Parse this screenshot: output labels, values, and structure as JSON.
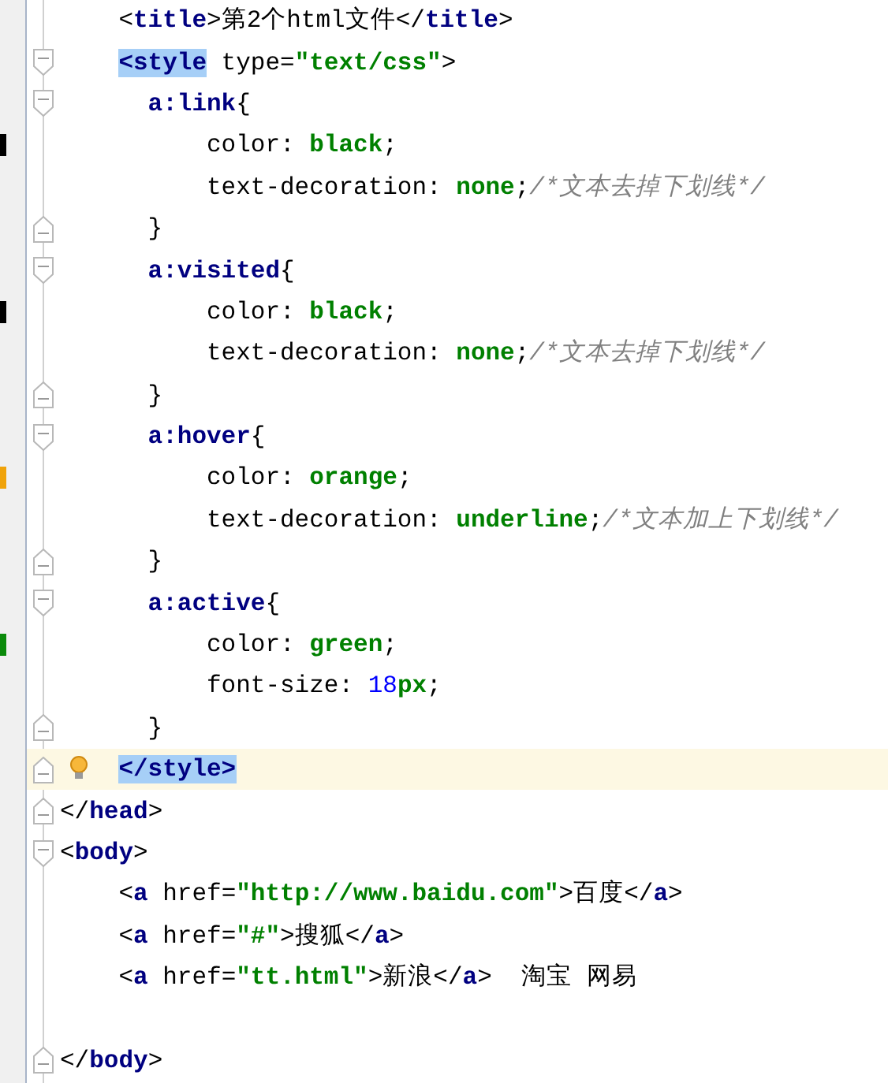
{
  "lines": [
    {
      "kind": "element",
      "fold_open": false,
      "fold_close": false,
      "tokens": [
        {
          "kind": "punct",
          "text": "<"
        },
        {
          "kind": "tag",
          "text": "title"
        },
        {
          "kind": "punct",
          "text": ">"
        },
        {
          "kind": "text",
          "text": "第2个html文件"
        },
        {
          "kind": "punct",
          "text": "</"
        },
        {
          "kind": "tag",
          "text": "title"
        },
        {
          "kind": "punct",
          "text": ">"
        }
      ]
    },
    {
      "kind": "element",
      "fold_open": true,
      "fold_close": false,
      "tokens": [
        {
          "kind": "tag",
          "text": "<style",
          "highlighted": true
        },
        {
          "kind": "attr",
          "text": " type="
        },
        {
          "kind": "string",
          "text": "\"text/css\""
        },
        {
          "kind": "punct",
          "text": ">"
        }
      ]
    },
    {
      "kind": "rule",
      "fold_open": true,
      "fold_close": false,
      "tokens": [
        {
          "kind": "selector",
          "text": "a:link"
        },
        {
          "kind": "punct",
          "text": "{"
        }
      ]
    },
    {
      "kind": "declaration",
      "fold_open": false,
      "fold_close": false,
      "color": "#000000",
      "tokens": [
        {
          "kind": "prop",
          "text": "color: "
        },
        {
          "kind": "value",
          "text": "black"
        },
        {
          "kind": "punct",
          "text": ";"
        }
      ]
    },
    {
      "kind": "declaration",
      "fold_open": false,
      "fold_close": false,
      "tokens": [
        {
          "kind": "prop",
          "text": "text-decoration: "
        },
        {
          "kind": "value",
          "text": "none"
        },
        {
          "kind": "punct",
          "text": ";"
        },
        {
          "kind": "comment",
          "text": "/*文本去掉下划线*/"
        }
      ]
    },
    {
      "kind": "rule",
      "fold_open": false,
      "fold_close": true,
      "tokens": [
        {
          "kind": "punct",
          "text": "}"
        }
      ]
    },
    {
      "kind": "rule",
      "fold_open": true,
      "fold_close": false,
      "tokens": [
        {
          "kind": "selector",
          "text": "a:visited"
        },
        {
          "kind": "punct",
          "text": "{"
        }
      ]
    },
    {
      "kind": "declaration",
      "fold_open": false,
      "fold_close": false,
      "color": "#000000",
      "tokens": [
        {
          "kind": "prop",
          "text": "color: "
        },
        {
          "kind": "value",
          "text": "black"
        },
        {
          "kind": "punct",
          "text": ";"
        }
      ]
    },
    {
      "kind": "declaration",
      "fold_open": false,
      "fold_close": false,
      "tokens": [
        {
          "kind": "prop",
          "text": "text-decoration: "
        },
        {
          "kind": "value",
          "text": "none"
        },
        {
          "kind": "punct",
          "text": ";"
        },
        {
          "kind": "comment",
          "text": "/*文本去掉下划线*/"
        }
      ]
    },
    {
      "kind": "rule",
      "fold_open": false,
      "fold_close": true,
      "tokens": [
        {
          "kind": "punct",
          "text": "}"
        }
      ]
    },
    {
      "kind": "rule",
      "fold_open": true,
      "fold_close": false,
      "tokens": [
        {
          "kind": "selector",
          "text": "a:hover"
        },
        {
          "kind": "punct",
          "text": "{"
        }
      ]
    },
    {
      "kind": "declaration",
      "fold_open": false,
      "fold_close": false,
      "color": "#f0a30a",
      "tokens": [
        {
          "kind": "prop",
          "text": "color: "
        },
        {
          "kind": "value",
          "text": "orange"
        },
        {
          "kind": "punct",
          "text": ";"
        }
      ]
    },
    {
      "kind": "declaration",
      "fold_open": false,
      "fold_close": false,
      "tokens": [
        {
          "kind": "prop",
          "text": "text-decoration: "
        },
        {
          "kind": "value",
          "text": "underline"
        },
        {
          "kind": "punct",
          "text": ";"
        },
        {
          "kind": "comment",
          "text": "/*文本加上下划线*/"
        }
      ]
    },
    {
      "kind": "rule",
      "fold_open": false,
      "fold_close": true,
      "tokens": [
        {
          "kind": "punct",
          "text": "}"
        }
      ]
    },
    {
      "kind": "rule",
      "fold_open": true,
      "fold_close": false,
      "tokens": [
        {
          "kind": "selector",
          "text": "a:active"
        },
        {
          "kind": "punct",
          "text": "{"
        }
      ]
    },
    {
      "kind": "declaration",
      "fold_open": false,
      "fold_close": false,
      "color": "#0a8a0a",
      "tokens": [
        {
          "kind": "prop",
          "text": "color: "
        },
        {
          "kind": "value",
          "text": "green"
        },
        {
          "kind": "punct",
          "text": ";"
        }
      ]
    },
    {
      "kind": "declaration",
      "fold_open": false,
      "fold_close": false,
      "tokens": [
        {
          "kind": "prop",
          "text": "font-size: "
        },
        {
          "kind": "number",
          "text": "18"
        },
        {
          "kind": "value",
          "text": "px"
        },
        {
          "kind": "punct",
          "text": ";"
        }
      ]
    },
    {
      "kind": "rule",
      "fold_open": false,
      "fold_close": true,
      "tokens": [
        {
          "kind": "punct",
          "text": "}"
        }
      ]
    },
    {
      "kind": "element",
      "fold_open": false,
      "fold_close": true,
      "current": true,
      "bulb": true,
      "tokens": [
        {
          "kind": "tag",
          "text": "</style>",
          "highlighted": true
        }
      ]
    },
    {
      "kind": "root",
      "fold_open": false,
      "fold_close": true,
      "tokens": [
        {
          "kind": "punct",
          "text": "</"
        },
        {
          "kind": "tag",
          "text": "head"
        },
        {
          "kind": "punct",
          "text": ">"
        }
      ]
    },
    {
      "kind": "root",
      "fold_open": true,
      "fold_close": false,
      "tokens": [
        {
          "kind": "punct",
          "text": "<"
        },
        {
          "kind": "tag",
          "text": "body"
        },
        {
          "kind": "punct",
          "text": ">"
        }
      ]
    },
    {
      "kind": "element",
      "fold_open": false,
      "fold_close": false,
      "tokens": [
        {
          "kind": "punct",
          "text": "<"
        },
        {
          "kind": "tag",
          "text": "a"
        },
        {
          "kind": "attr",
          "text": " href="
        },
        {
          "kind": "string",
          "text": "\"http://www.baidu.com\""
        },
        {
          "kind": "punct",
          "text": ">"
        },
        {
          "kind": "text",
          "text": "百度"
        },
        {
          "kind": "punct",
          "text": "</"
        },
        {
          "kind": "tag",
          "text": "a"
        },
        {
          "kind": "punct",
          "text": ">"
        }
      ]
    },
    {
      "kind": "element",
      "fold_open": false,
      "fold_close": false,
      "tokens": [
        {
          "kind": "punct",
          "text": "<"
        },
        {
          "kind": "tag",
          "text": "a"
        },
        {
          "kind": "attr",
          "text": " href="
        },
        {
          "kind": "string",
          "text": "\"#\""
        },
        {
          "kind": "punct",
          "text": ">"
        },
        {
          "kind": "text",
          "text": "搜狐"
        },
        {
          "kind": "punct",
          "text": "</"
        },
        {
          "kind": "tag",
          "text": "a"
        },
        {
          "kind": "punct",
          "text": ">"
        }
      ]
    },
    {
      "kind": "element",
      "fold_open": false,
      "fold_close": false,
      "tokens": [
        {
          "kind": "punct",
          "text": "<"
        },
        {
          "kind": "tag",
          "text": "a"
        },
        {
          "kind": "attr",
          "text": " href="
        },
        {
          "kind": "string",
          "text": "\"tt.html\""
        },
        {
          "kind": "punct",
          "text": ">"
        },
        {
          "kind": "text",
          "text": "新浪"
        },
        {
          "kind": "punct",
          "text": "</"
        },
        {
          "kind": "tag",
          "text": "a"
        },
        {
          "kind": "punct",
          "text": ">"
        },
        {
          "kind": "text",
          "text": "  淘宝 网易"
        }
      ]
    },
    {
      "kind": "root",
      "blank_line_before": true,
      "fold_open": false,
      "fold_close": true,
      "tokens": [
        {
          "kind": "punct",
          "text": "</"
        },
        {
          "kind": "tag",
          "text": "body"
        },
        {
          "kind": "punct",
          "text": ">"
        }
      ]
    }
  ]
}
